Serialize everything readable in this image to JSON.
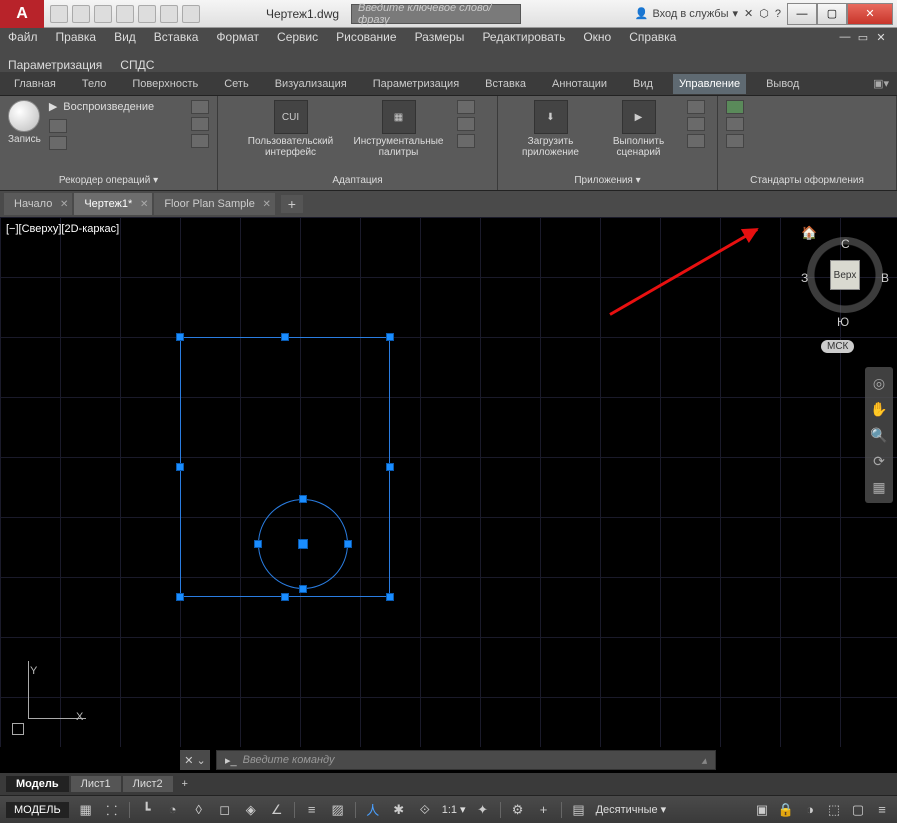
{
  "titlebar": {
    "filename": "Чертеж1.dwg",
    "search_placeholder": "Введите ключевое слово/фразу",
    "signin": "Вход в службы"
  },
  "menu": {
    "row1": [
      "Файл",
      "Правка",
      "Вид",
      "Вставка",
      "Формат",
      "Сервис",
      "Рисование",
      "Размеры",
      "Редактировать",
      "Окно",
      "Справка"
    ],
    "row2": [
      "Параметризация",
      "СПДС"
    ]
  },
  "ribbon_tabs": [
    "Главная",
    "Тело",
    "Поверхность",
    "Сеть",
    "Визуализация",
    "Параметризация",
    "Вставка",
    "Аннотации",
    "Вид",
    "Управление",
    "Вывод"
  ],
  "ribbon_active": "Управление",
  "ribbon": {
    "panel1": {
      "title": "Рекордер операций ▾",
      "record": "Запись",
      "play": "Воспроизведение"
    },
    "panel2": {
      "title": "Адаптация",
      "btn1": "Пользовательский интерфейс",
      "btn1_ico": "CUI",
      "btn2": "Инструментальные палитры"
    },
    "panel3": {
      "title": "Приложения ▾",
      "btn1": "Загрузить приложение",
      "btn2": "Выполнить сценарий"
    },
    "panel4": {
      "title": "Стандарты оформления"
    }
  },
  "filetabs": [
    "Начало",
    "Чертеж1*",
    "Floor Plan Sample"
  ],
  "filetab_active": 1,
  "viewport": {
    "label": "[−][Сверху][2D-каркас]"
  },
  "viewcube": {
    "face": "Верх",
    "n": "С",
    "s": "Ю",
    "w": "З",
    "e": "В",
    "cs": "МСК"
  },
  "axis": {
    "x": "X",
    "y": "Y"
  },
  "cmdline": {
    "prompt": "▸_",
    "placeholder": "Введите команду"
  },
  "layout_tabs": [
    "Модель",
    "Лист1",
    "Лист2"
  ],
  "status": {
    "model": "МОДЕЛЬ",
    "scale": "1:1 ▾",
    "decimal": "Десятичные ▾"
  }
}
